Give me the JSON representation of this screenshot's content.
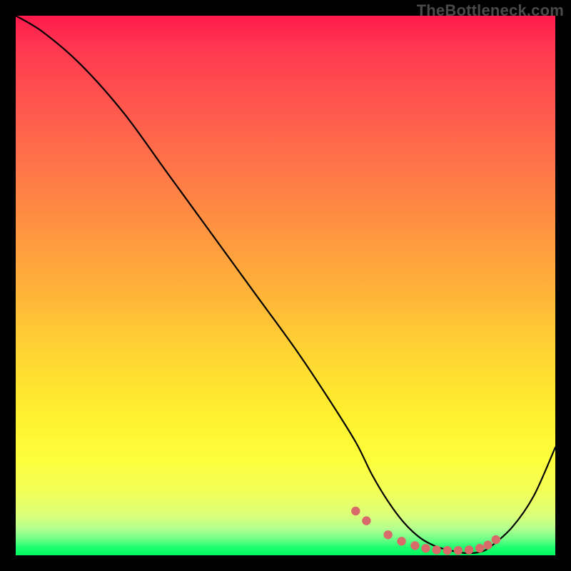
{
  "watermark": "TheBottleneck.com",
  "chart_data": {
    "type": "line",
    "title": "",
    "xlabel": "",
    "ylabel": "",
    "xlim": [
      0,
      100
    ],
    "ylim": [
      0,
      100
    ],
    "grid": false,
    "series": [
      {
        "name": "curve",
        "style": "black-line",
        "x": [
          0,
          5,
          12,
          20,
          28,
          36,
          44,
          52,
          58,
          63,
          66,
          69,
          72,
          75,
          78,
          81,
          83.5,
          86,
          88,
          92,
          96,
          100
        ],
        "values": [
          100,
          97,
          91,
          82,
          71,
          60,
          49,
          38,
          29,
          21,
          15,
          10,
          6,
          3.2,
          1.6,
          0.8,
          0.4,
          0.6,
          1.6,
          5.2,
          11,
          20
        ]
      },
      {
        "name": "low-bottleneck-markers",
        "style": "red-dots",
        "x": [
          63,
          65,
          69,
          71.5,
          74,
          76,
          78,
          80,
          82,
          84,
          86,
          87.5,
          89
        ],
        "values": [
          8.2,
          6.4,
          3.8,
          2.6,
          1.8,
          1.3,
          1.0,
          0.9,
          0.9,
          1.0,
          1.3,
          1.9,
          2.9
        ]
      }
    ],
    "colors": {
      "gradient_top": "#ff1a4d",
      "gradient_mid": "#ffe033",
      "gradient_bot": "#00f75e",
      "curve": "#000000",
      "marker": "#d86a6a"
    }
  }
}
